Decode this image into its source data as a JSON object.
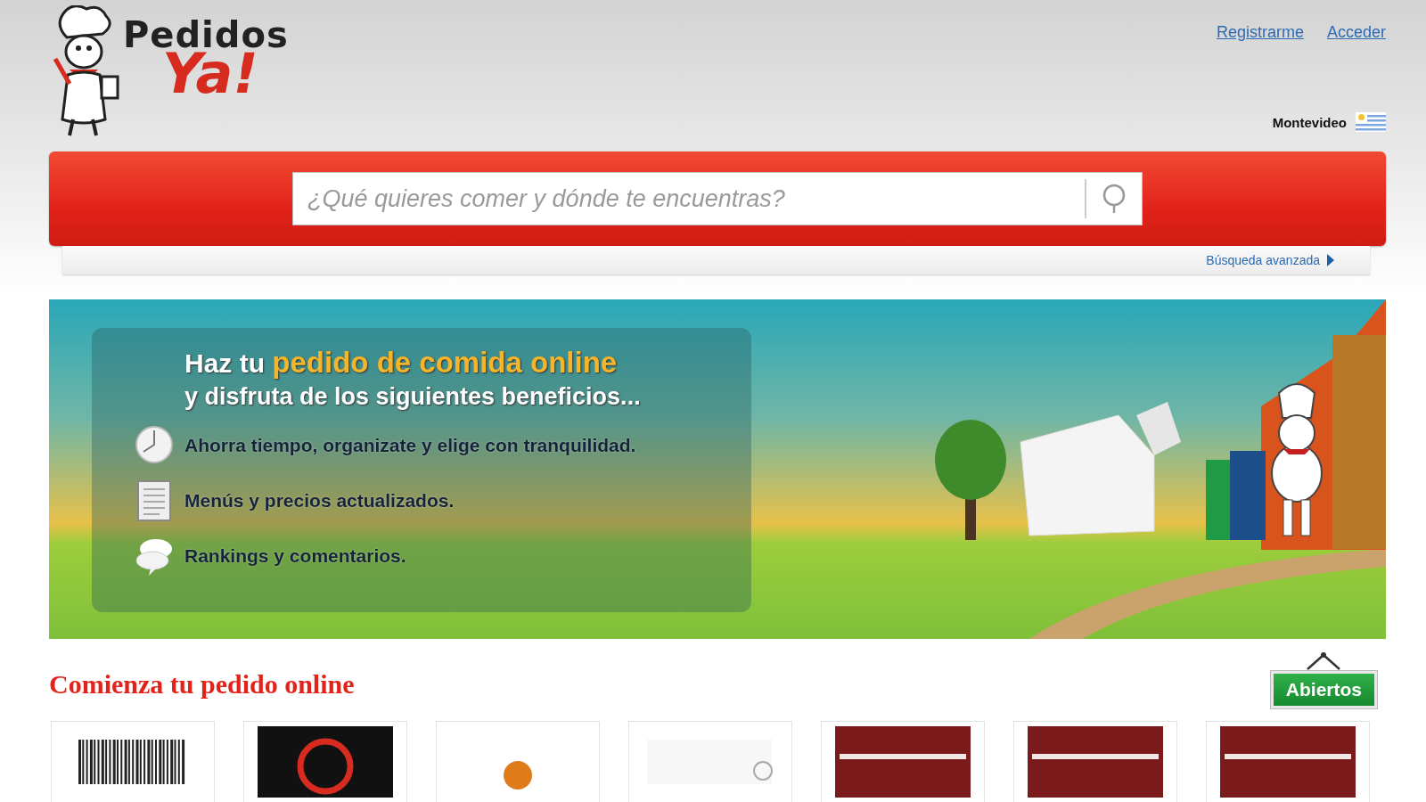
{
  "header": {
    "logo": {
      "line1": "Pedidos",
      "line2": "Ya!"
    },
    "links": [
      "Registrarme",
      "Acceder"
    ],
    "city": "Montevideo"
  },
  "search": {
    "placeholder": "¿Qué quieres comer y dónde te encuentras?"
  },
  "advanced_search": "Búsqueda avanzada",
  "banner": {
    "title_lead": "Haz tu",
    "title_highlight": "pedido de comida online",
    "subtitle": "y disfruta de los siguientes beneficios...",
    "benefits": [
      {
        "kind": "clock",
        "text": "Ahorra tiempo, organizate y elige con tranquilidad."
      },
      {
        "kind": "menu",
        "text": "Menús y precios actualizados."
      },
      {
        "kind": "chat",
        "text": "Rankings y comentarios."
      }
    ]
  },
  "section": {
    "title": "Comienza tu pedido online",
    "filter_button": "Abiertos"
  },
  "restaurants": [
    {
      "kind": "barcode"
    },
    {
      "kind": "dark"
    },
    {
      "kind": "orange"
    },
    {
      "kind": "light"
    },
    {
      "kind": "maroon"
    },
    {
      "kind": "maroon"
    },
    {
      "kind": "maroon"
    }
  ]
}
